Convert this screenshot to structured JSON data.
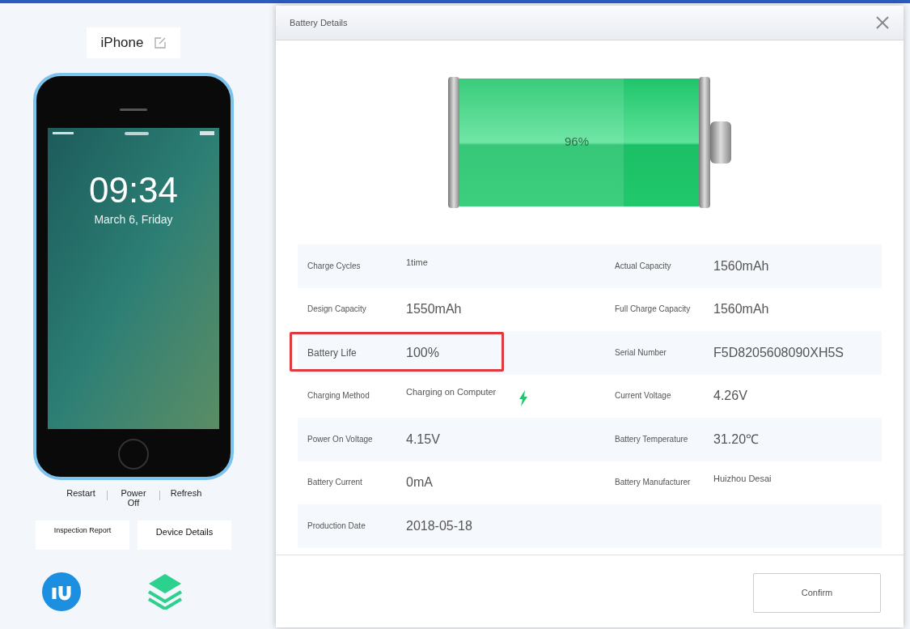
{
  "device": {
    "name": "iPhone",
    "time": "09:34",
    "date": "March 6, Friday"
  },
  "device_actions": [
    "Restart",
    "Power Off",
    "Refresh"
  ],
  "device_buttons": [
    "Inspection Report",
    "Device Details"
  ],
  "dialog": {
    "title": "Battery Details",
    "battery_reading": "96%",
    "rows": [
      {
        "cells": [
          {
            "label": "Charge Cycles",
            "value": "1time",
            "kind": "small",
            "highlighted": false,
            "charging": false
          },
          {
            "label": "Actual Capacity",
            "value": "1560mAh",
            "kind": "large",
            "highlighted": false,
            "charging": false
          }
        ]
      },
      {
        "cells": [
          {
            "label": "Design Capacity",
            "value": "1550mAh",
            "kind": "large",
            "highlighted": false,
            "charging": false
          },
          {
            "label": "Full Charge Capacity",
            "value": "1560mAh",
            "kind": "large",
            "highlighted": false,
            "charging": false
          }
        ]
      },
      {
        "cells": [
          {
            "label": "Battery Life",
            "value": "100%",
            "kind": "large",
            "highlighted": true,
            "charging": false
          },
          {
            "label": "Serial Number",
            "value": "F5D8205608090XH5S",
            "kind": "large",
            "highlighted": false,
            "charging": false
          }
        ]
      },
      {
        "cells": [
          {
            "label": "Charging Method",
            "value": "Charging on Computer",
            "kind": "small",
            "highlighted": false,
            "charging": true
          },
          {
            "label": "Current Voltage",
            "value": "4.26V",
            "kind": "large",
            "highlighted": false,
            "charging": false
          }
        ]
      },
      {
        "cells": [
          {
            "label": "Power On Voltage",
            "value": "4.15V",
            "kind": "large",
            "highlighted": false,
            "charging": false
          },
          {
            "label": "Battery Temperature",
            "value": "31.20℃",
            "kind": "large",
            "highlighted": false,
            "charging": false
          }
        ]
      },
      {
        "cells": [
          {
            "label": "Battery Current",
            "value": "0mA",
            "kind": "large",
            "highlighted": false,
            "charging": false
          },
          {
            "label": "Battery Manufacturer",
            "value": "Huizhou Desai",
            "kind": "small",
            "highlighted": false,
            "charging": false
          }
        ]
      },
      {
        "cells": [
          {
            "label": "Production Date",
            "value": "2018-05-18",
            "kind": "large",
            "highlighted": false,
            "charging": false
          }
        ]
      }
    ],
    "confirm_button": "Confirm"
  }
}
